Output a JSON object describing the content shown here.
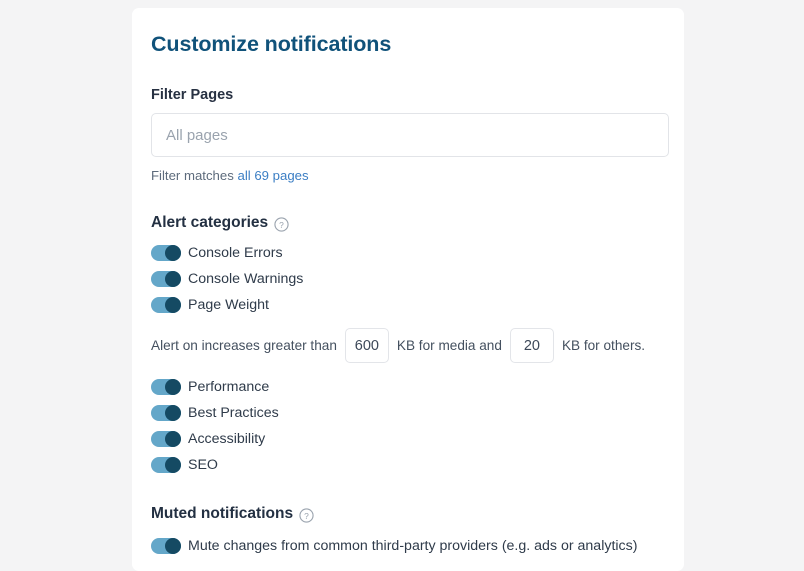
{
  "card": {
    "title": "Customize notifications",
    "filter": {
      "label": "Filter Pages",
      "input_value": "",
      "input_placeholder": "All pages",
      "matches_prefix": "Filter matches ",
      "matches_link": "all 69 pages"
    },
    "alert_categories": {
      "heading": "Alert categories",
      "help_icon": "help-circle-icon",
      "toggles_top": [
        {
          "label": "Console Errors",
          "on": true
        },
        {
          "label": "Console Warnings",
          "on": true
        },
        {
          "label": "Page Weight",
          "on": true
        }
      ],
      "page_weight_rule": {
        "prefix": "Alert on increases greater than",
        "media_value": "600",
        "middle": "KB for media and",
        "others_value": "20",
        "suffix": "KB for others."
      },
      "toggles_bottom": [
        {
          "label": "Performance",
          "on": true
        },
        {
          "label": "Best Practices",
          "on": true
        },
        {
          "label": "Accessibility",
          "on": true
        },
        {
          "label": "SEO",
          "on": true
        }
      ]
    },
    "muted_notifications": {
      "heading": "Muted notifications",
      "help_icon": "help-circle-icon",
      "toggle": {
        "label": "Mute changes from common third-party providers (e.g. ads or analytics)",
        "on": true
      }
    }
  },
  "colors": {
    "page_background": "#f4f4f5",
    "card_background": "#ffffff",
    "title": "#10527a",
    "link": "#3b7ec4",
    "toggle_track_on": "#64a7c9",
    "toggle_knob_on": "#154a63",
    "body_text": "#2f3b4a",
    "border": "#e2e4e8"
  }
}
